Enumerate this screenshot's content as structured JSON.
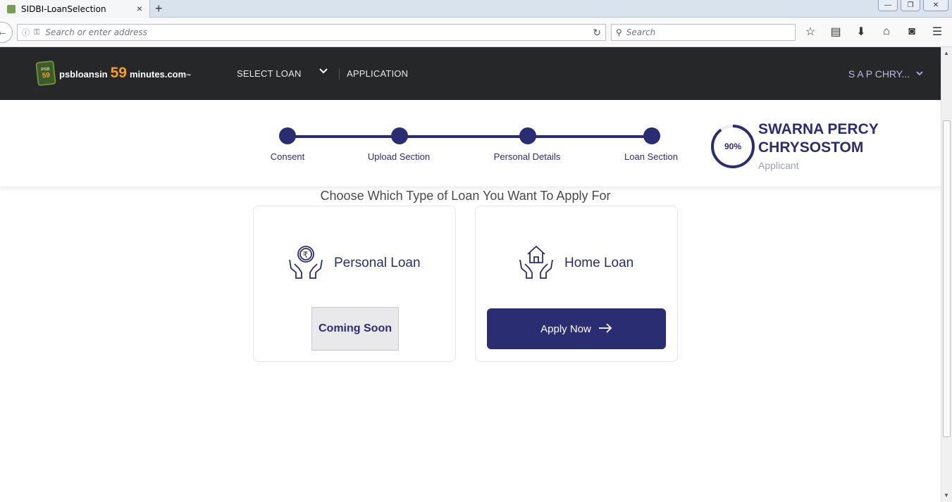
{
  "browser": {
    "tab_title": "SIDBI-LoanSelection",
    "tab_close": "×",
    "new_tab": "+",
    "address_placeholder": "Search or enter address",
    "search_placeholder": "Search",
    "window_buttons": {
      "minimize": "—",
      "restore": "❐",
      "close": "✕"
    },
    "toolbar_icons": [
      "star-icon",
      "reading-list-icon",
      "download-icon",
      "home-icon",
      "pocket-icon",
      "menu-icon"
    ]
  },
  "header": {
    "logo_badge_top": "PSB",
    "logo_badge_num": "59",
    "logo_prefix": "psbloansin",
    "logo_number": "59",
    "logo_suffix": "minutes.com",
    "logo_tm": "™",
    "nav_select_loan": "SELECT LOAN",
    "nav_application": "APPLICATION",
    "user_name": "S A P CHRY..."
  },
  "stepper": {
    "steps": [
      {
        "label": "Consent"
      },
      {
        "label": "Upload Section"
      },
      {
        "label": "Personal Details"
      },
      {
        "label": "Loan Section"
      }
    ],
    "progress_percent": 90,
    "progress_text": "90%",
    "applicant_name": "SWARNA PERCY CHRYSOSTOM",
    "applicant_role": "Applicant"
  },
  "main": {
    "heading": "Choose Which Type of Loan You Want To Apply For",
    "cards": [
      {
        "title": "Personal Loan",
        "button": "Coming Soon"
      },
      {
        "title": "Home Loan",
        "button": "Apply Now"
      }
    ]
  },
  "colors": {
    "brand": "#2b2d72",
    "header_bg": "#262728",
    "accent": "#f4a023"
  }
}
